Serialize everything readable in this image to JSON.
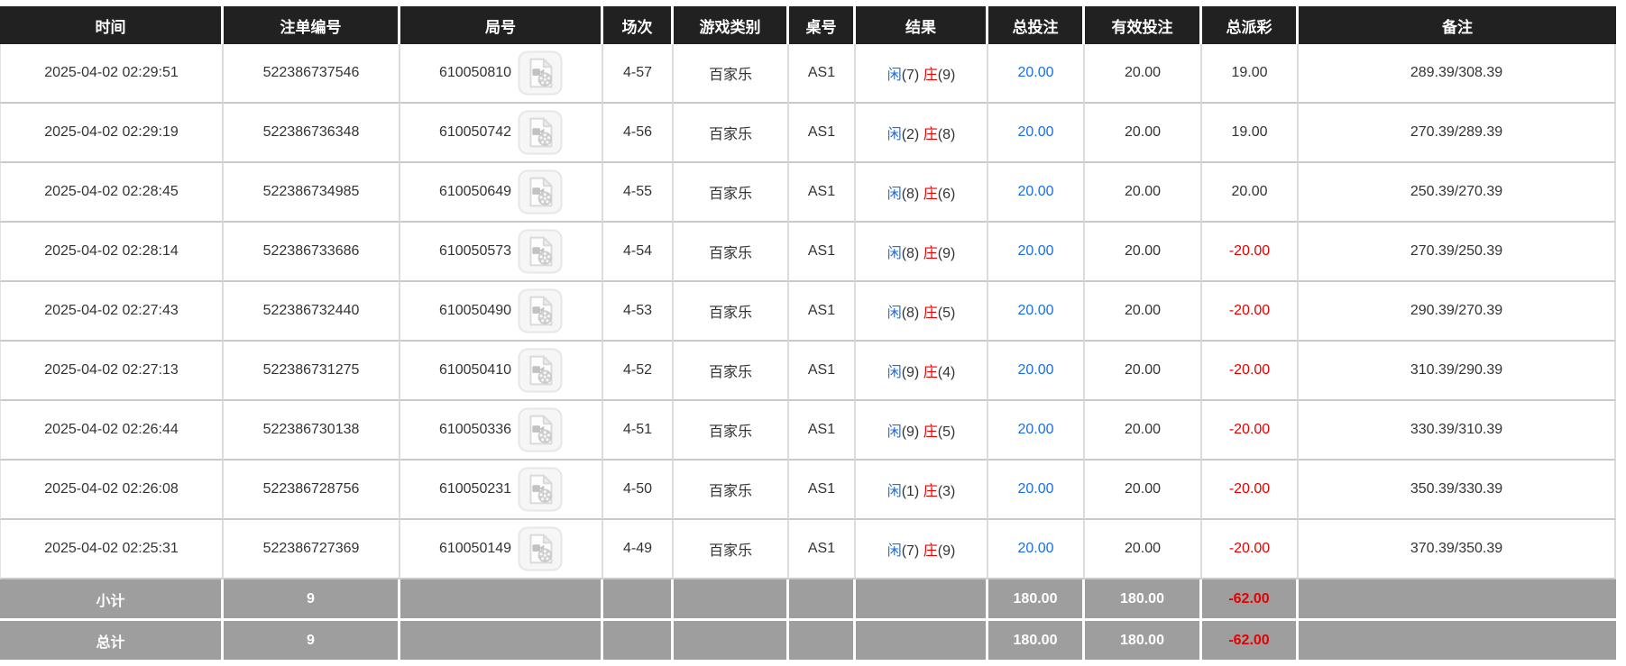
{
  "colors": {
    "header_bg": "#212121",
    "totals_bg": "#9e9e9e",
    "accent_blue": "#1a6fe8",
    "accent_red": "#e60000",
    "body_text": "#333333"
  },
  "table": {
    "columns": [
      "时间",
      "注单编号",
      "局号",
      "场次",
      "游戏类别",
      "桌号",
      "结果",
      "总投注",
      "有效投注",
      "总派彩",
      "备注"
    ],
    "icons": {
      "video_icon": "video-replay-icon"
    },
    "rows": [
      {
        "time": "2025-04-02 02:29:51",
        "bet_id": "522386737546",
        "round_id": "610050810",
        "session": "4-57",
        "game": "百家乐",
        "table_no": "AS1",
        "p_label": "闲",
        "p_score": "(7)",
        "b_label": "庄",
        "b_score": "(9)",
        "total_bet": "20.00",
        "valid_bet": "20.00",
        "payout": "19.00",
        "remark": "289.39/308.39"
      },
      {
        "time": "2025-04-02 02:29:19",
        "bet_id": "522386736348",
        "round_id": "610050742",
        "session": "4-56",
        "game": "百家乐",
        "table_no": "AS1",
        "p_label": "闲",
        "p_score": "(2)",
        "b_label": "庄",
        "b_score": "(8)",
        "total_bet": "20.00",
        "valid_bet": "20.00",
        "payout": "19.00",
        "remark": "270.39/289.39"
      },
      {
        "time": "2025-04-02 02:28:45",
        "bet_id": "522386734985",
        "round_id": "610050649",
        "session": "4-55",
        "game": "百家乐",
        "table_no": "AS1",
        "p_label": "闲",
        "p_score": "(8)",
        "b_label": "庄",
        "b_score": "(6)",
        "total_bet": "20.00",
        "valid_bet": "20.00",
        "payout": "20.00",
        "remark": "250.39/270.39"
      },
      {
        "time": "2025-04-02 02:28:14",
        "bet_id": "522386733686",
        "round_id": "610050573",
        "session": "4-54",
        "game": "百家乐",
        "table_no": "AS1",
        "p_label": "闲",
        "p_score": "(8)",
        "b_label": "庄",
        "b_score": "(9)",
        "total_bet": "20.00",
        "valid_bet": "20.00",
        "payout": "-20.00",
        "remark": "270.39/250.39"
      },
      {
        "time": "2025-04-02 02:27:43",
        "bet_id": "522386732440",
        "round_id": "610050490",
        "session": "4-53",
        "game": "百家乐",
        "table_no": "AS1",
        "p_label": "闲",
        "p_score": "(8)",
        "b_label": "庄",
        "b_score": "(5)",
        "total_bet": "20.00",
        "valid_bet": "20.00",
        "payout": "-20.00",
        "remark": "290.39/270.39"
      },
      {
        "time": "2025-04-02 02:27:13",
        "bet_id": "522386731275",
        "round_id": "610050410",
        "session": "4-52",
        "game": "百家乐",
        "table_no": "AS1",
        "p_label": "闲",
        "p_score": "(9)",
        "b_label": "庄",
        "b_score": "(4)",
        "total_bet": "20.00",
        "valid_bet": "20.00",
        "payout": "-20.00",
        "remark": "310.39/290.39"
      },
      {
        "time": "2025-04-02 02:26:44",
        "bet_id": "522386730138",
        "round_id": "610050336",
        "session": "4-51",
        "game": "百家乐",
        "table_no": "AS1",
        "p_label": "闲",
        "p_score": "(9)",
        "b_label": "庄",
        "b_score": "(5)",
        "total_bet": "20.00",
        "valid_bet": "20.00",
        "payout": "-20.00",
        "remark": "330.39/310.39"
      },
      {
        "time": "2025-04-02 02:26:08",
        "bet_id": "522386728756",
        "round_id": "610050231",
        "session": "4-50",
        "game": "百家乐",
        "table_no": "AS1",
        "p_label": "闲",
        "p_score": "(1)",
        "b_label": "庄",
        "b_score": "(3)",
        "total_bet": "20.00",
        "valid_bet": "20.00",
        "payout": "-20.00",
        "remark": "350.39/330.39"
      },
      {
        "time": "2025-04-02 02:25:31",
        "bet_id": "522386727369",
        "round_id": "610050149",
        "session": "4-49",
        "game": "百家乐",
        "table_no": "AS1",
        "p_label": "闲",
        "p_score": "(7)",
        "b_label": "庄",
        "b_score": "(9)",
        "total_bet": "20.00",
        "valid_bet": "20.00",
        "payout": "-20.00",
        "remark": "370.39/350.39"
      }
    ],
    "subtotal": {
      "label": "小计",
      "count": "9",
      "total_bet": "180.00",
      "valid_bet": "180.00",
      "payout": "-62.00"
    },
    "grand_total": {
      "label": "总计",
      "count": "9",
      "total_bet": "180.00",
      "valid_bet": "180.00",
      "payout": "-62.00"
    }
  }
}
